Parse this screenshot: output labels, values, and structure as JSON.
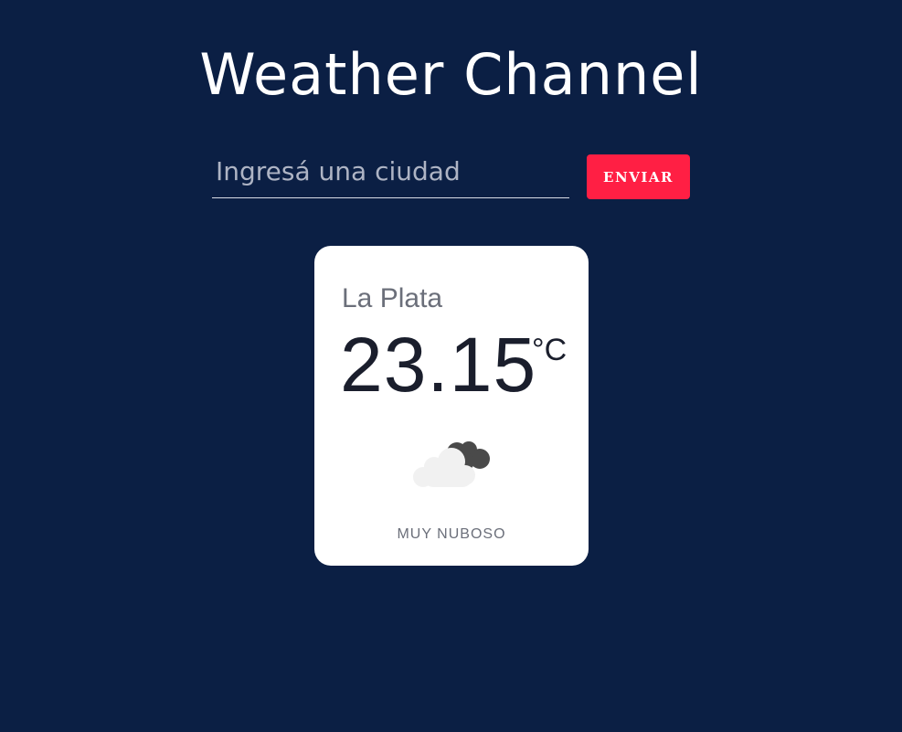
{
  "header": {
    "title": "Weather Channel"
  },
  "search": {
    "placeholder": "Ingresá una ciudad",
    "value": "",
    "submit_label": "ENVIAR"
  },
  "weather": {
    "city": "La Plata",
    "temperature": "23.15",
    "unit": "°C",
    "icon": "broken-clouds-icon",
    "description": "MUY NUBOSO"
  },
  "colors": {
    "background": "#0b1f44",
    "accent": "#ff1f44",
    "card": "#ffffff"
  }
}
